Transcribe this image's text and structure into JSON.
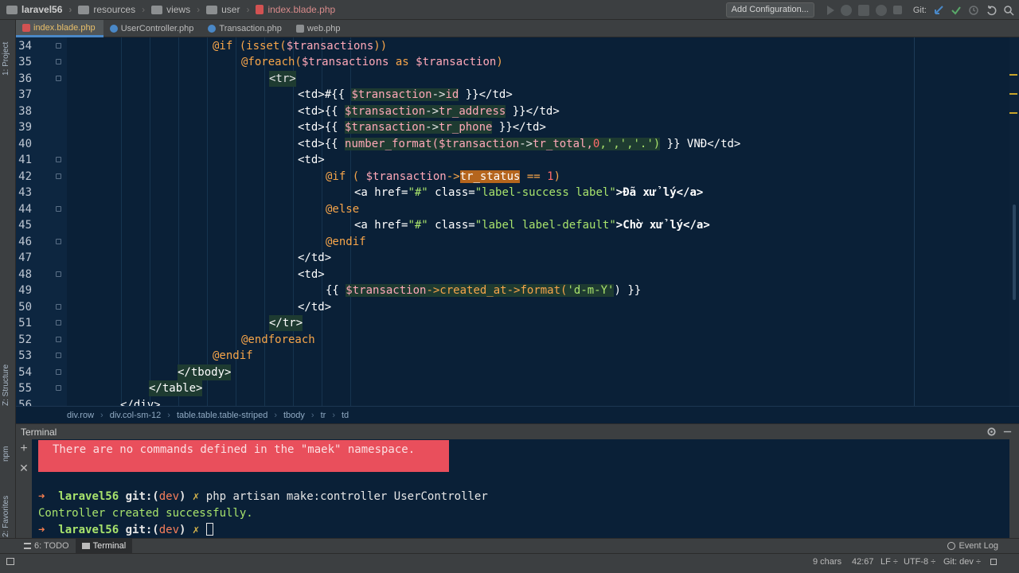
{
  "breadcrumbs": [
    "laravel56",
    "resources",
    "views",
    "user",
    "index.blade.php"
  ],
  "toolbar": {
    "add_config": "Add Configuration...",
    "git_label": "Git:"
  },
  "tabs": [
    {
      "label": "index.blade.php",
      "active": true,
      "color": "#d25252"
    },
    {
      "label": "UserController.php",
      "active": false,
      "color": "#4a88c7"
    },
    {
      "label": "Transaction.php",
      "active": false,
      "color": "#4a88c7"
    },
    {
      "label": "web.php",
      "active": false,
      "color": "#8c8f91"
    }
  ],
  "side_labels": {
    "project": "1: Project",
    "structure": "Z: Structure",
    "npm": "npm",
    "favorites": "2: Favorites"
  },
  "code_lines": [
    {
      "n": "34"
    },
    {
      "n": "35"
    },
    {
      "n": "36"
    },
    {
      "n": "37"
    },
    {
      "n": "38"
    },
    {
      "n": "39"
    },
    {
      "n": "40"
    },
    {
      "n": "41"
    },
    {
      "n": "42"
    },
    {
      "n": "43"
    },
    {
      "n": "44"
    },
    {
      "n": "45"
    },
    {
      "n": "46"
    },
    {
      "n": "47"
    },
    {
      "n": "48"
    },
    {
      "n": "49"
    },
    {
      "n": "50"
    },
    {
      "n": "51"
    },
    {
      "n": "52"
    },
    {
      "n": "53"
    },
    {
      "n": "54"
    },
    {
      "n": "55"
    },
    {
      "n": "56"
    }
  ],
  "code": {
    "l34": [
      "@if (isset(",
      "$transactions",
      "))"
    ],
    "l35": [
      "@foreach(",
      "$transactions",
      " as ",
      "$transaction",
      ")"
    ],
    "l36": "<tr>",
    "l37": [
      "<td>#{{ ",
      "$transaction",
      "->",
      "id",
      " }}</td>"
    ],
    "l38": [
      "<td>{{ ",
      "$transaction",
      "->",
      "tr_address",
      " }}</td>"
    ],
    "l39": [
      "<td>{{ ",
      "$transaction",
      "->",
      "tr_phone",
      " }}</td>"
    ],
    "l40": [
      "<td>{{ ",
      "number_format(",
      "$transaction",
      "->",
      "tr_total,",
      "0",
      ",','",
      ",'.')",
      " }} VNĐ</td>"
    ],
    "l41": "<td>",
    "l42": [
      "@if ( ",
      "$transaction",
      "->",
      "tr_status",
      " == ",
      "1",
      ")"
    ],
    "l43": [
      "<a href=",
      "\"#\"",
      " class=",
      "\"label-success label\"",
      ">Đã xử lý</a>"
    ],
    "l44": "@else",
    "l45": [
      "<a href=",
      "\"#\"",
      " class=",
      "\"label label-default\"",
      ">Chờ xử lý</a>"
    ],
    "l46": "@endif",
    "l47": "</td>",
    "l48": "<td>",
    "l49": [
      "{{ ",
      "$transaction",
      "->created_at->format(",
      "'d-m-Y'",
      ") }}"
    ],
    "l50": "</td>",
    "l51": "</tr>",
    "l52": "@endforeach",
    "l53": "@endif",
    "l54": "</tbody>",
    "l55": "</table>",
    "l56": "</div>"
  },
  "breadcrumb_path": [
    "div.row",
    "div.col-sm-12",
    "table.table.table-striped",
    "tbody",
    "tr",
    "td"
  ],
  "terminal": {
    "title": "Terminal",
    "error": "There are no commands defined in the \"maek\" namespace.",
    "prompt_name": "laravel56",
    "git_prefix": "git:(",
    "branch": "dev",
    "git_suffix": ")",
    "command": "php artisan make:controller UserController",
    "output": "Controller created successfully."
  },
  "bottom_tabs": {
    "todo": "6: TODO",
    "terminal": "Terminal"
  },
  "status": {
    "chars": "9 chars",
    "pos": "42:67",
    "lf": "LF ÷",
    "enc": "UTF-8 ÷",
    "git": "Git: dev ÷",
    "event_log": "Event Log"
  }
}
